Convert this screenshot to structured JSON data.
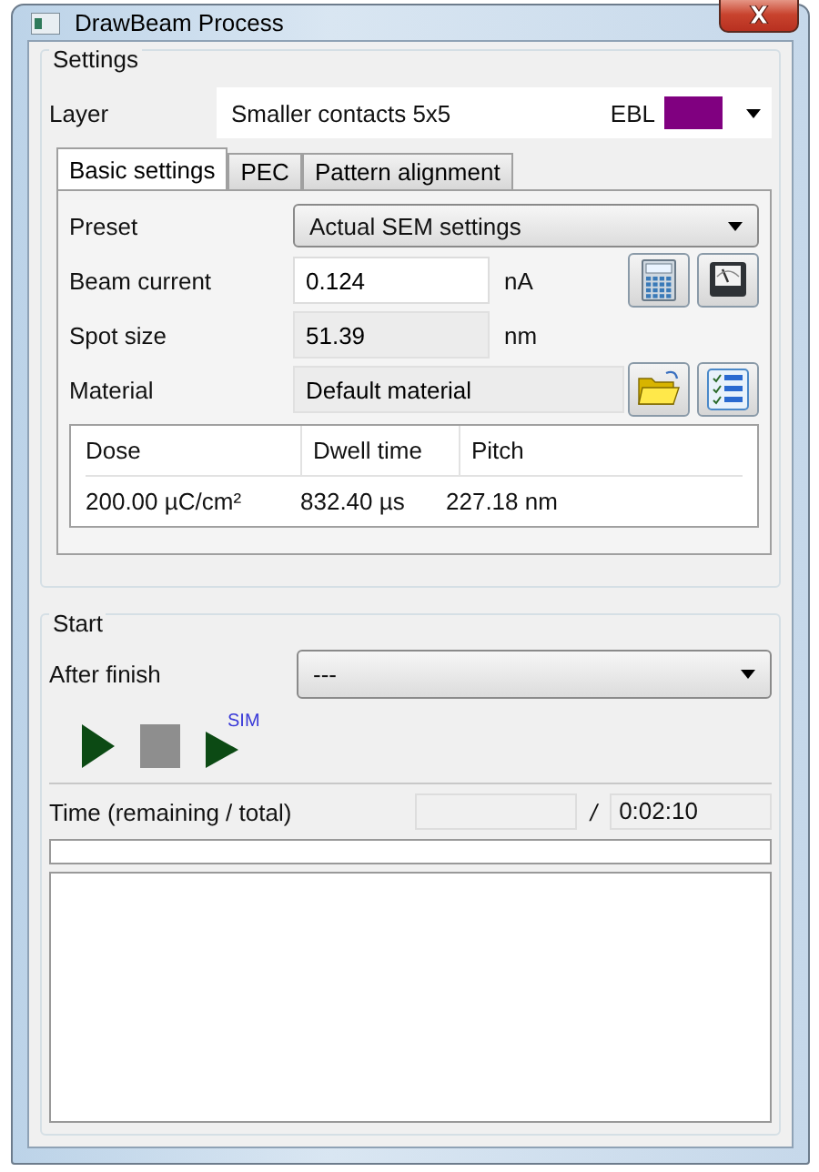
{
  "window": {
    "title": "DrawBeam Process"
  },
  "settings": {
    "title": "Settings",
    "layer": {
      "label": "Layer",
      "value": "Smaller contacts 5x5",
      "tag": "EBL",
      "color": "#800080"
    }
  },
  "tabs": [
    {
      "label": "Basic settings",
      "selected": true
    },
    {
      "label": "PEC",
      "selected": false
    },
    {
      "label": "Pattern alignment",
      "selected": false
    }
  ],
  "basic": {
    "preset": {
      "label": "Preset",
      "value": "Actual SEM settings"
    },
    "fields": [
      {
        "label": "Beam current",
        "value": "0.124",
        "unit": "nA",
        "readonly": false
      },
      {
        "label": "Spot size",
        "value": "51.39",
        "unit": "nm",
        "readonly": true
      },
      {
        "label": "Material",
        "value": "Default material",
        "readonly": true
      }
    ],
    "table": {
      "columns": [
        "Dose",
        "Dwell time",
        "Pitch"
      ],
      "rows": [
        [
          "200.00 µC/cm²",
          "832.40 µs",
          "227.18 nm"
        ]
      ]
    }
  },
  "start": {
    "title": "Start",
    "after_finish": {
      "label": "After finish",
      "value": "---"
    },
    "controls": [
      {
        "kind": "play",
        "disabled": false
      },
      {
        "kind": "stop",
        "disabled": true
      },
      {
        "kind": "sim",
        "label": "SIM",
        "disabled": false
      }
    ],
    "time": {
      "label": "Time (remaining / total)",
      "separator": "/",
      "total": "0:02:10"
    },
    "progress": {
      "level": 0
    }
  }
}
